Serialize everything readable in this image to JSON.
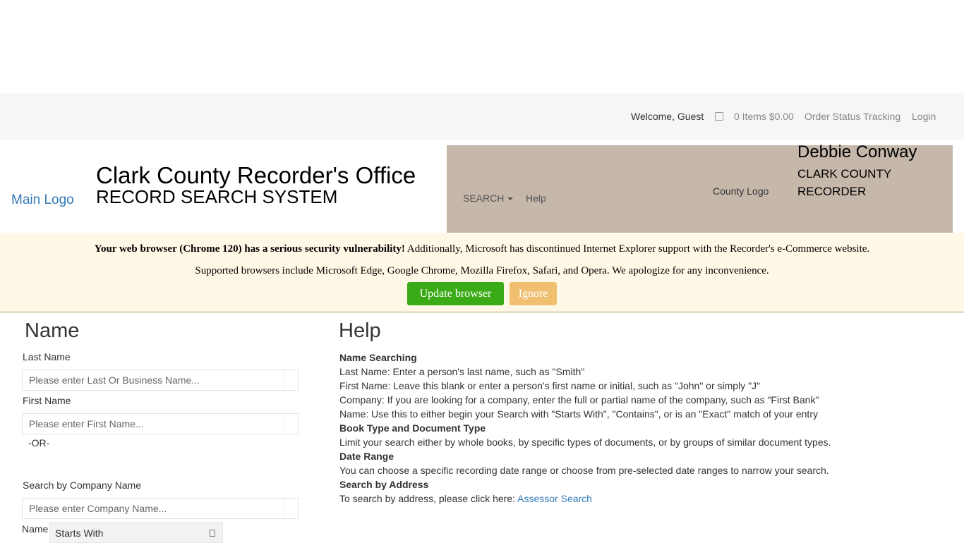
{
  "topbar": {
    "welcome": "Welcome, Guest",
    "cart_icon": "cart-icon",
    "cart": "0 Items $0.00",
    "order_status": "Order Status Tracking",
    "login": "Login"
  },
  "header": {
    "main_logo_alt": "Main Logo",
    "title": "Clark County Recorder's Office",
    "subtitle": "RECORD SEARCH SYSTEM",
    "nav": {
      "search": "SEARCH",
      "help": "Help"
    },
    "county_logo_alt": "County Logo",
    "recorder_name": "Debbie Conway",
    "recorder_title": "CLARK COUNTY RECORDER",
    "nav_panel_color": "#c5b7aa"
  },
  "alert": {
    "bold_text": "Your web browser (Chrome 120) has a serious security vulnerability!",
    "text_1": " Additionally, Microsoft has discontinued Internet Explorer support with the Recorder's e-Commerce website.",
    "text_2": "Supported browsers include Microsoft Edge, Google Chrome, Mozilla Firefox, Safari, and Opera. We apologize for any inconvenience.",
    "update_button": "Update browser",
    "ignore_button": "Ignore",
    "update_color": "#3aaa16",
    "ignore_color": "#f0c070"
  },
  "name_form": {
    "heading": "Name",
    "last_name_label": "Last Name",
    "last_name_placeholder": "Please enter Last Or Business Name...",
    "first_name_label": "First Name",
    "first_name_placeholder": "Please enter First Name...",
    "or_text": "-OR-",
    "company_label": "Search by Company Name",
    "company_placeholder": "Please enter Company Name...",
    "match_label": "Name",
    "match_value": "Starts With"
  },
  "help": {
    "heading": "Help",
    "name_searching_title": "Name Searching",
    "name_line_1": "Last Name: Enter a person's last name, such as \"Smith\"",
    "name_line_2": "First Name: Leave this blank or enter a person's first name or initial, such as \"John\" or simply \"J\"",
    "name_line_3": "Company: If you are looking for a company, enter the full or partial name of the company, such as \"First Bank\"",
    "name_line_4": "Name: Use this to either begin your Search with \"Starts With\", \"Contains\", or is an \"Exact\" match of your entry",
    "book_type_title": "Book Type and Document Type",
    "book_type_text": "Limit your search either by whole books, by specific types of documents, or by groups of similar document types.",
    "date_range_title": "Date Range",
    "date_range_text": "You can choose a specific recording date range or choose from pre-selected date ranges to narrow your search.",
    "address_title": "Search by Address",
    "address_text": "To search by address, please click here: ",
    "assessor_link": "Assessor Search"
  }
}
